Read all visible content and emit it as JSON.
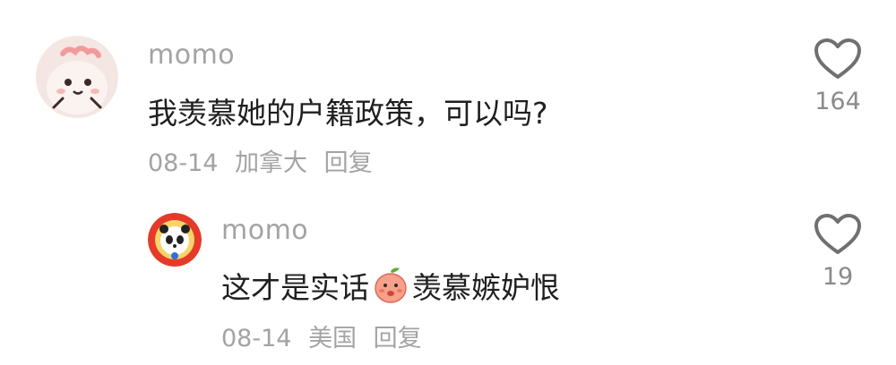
{
  "comments": [
    {
      "username": "momo",
      "text": "我羡慕她的户籍政策，可以吗?",
      "date": "08-14",
      "location": "加拿大",
      "reply_label": "回复",
      "like_count": "164"
    },
    {
      "username": "momo",
      "text_before_emoji": "这才是实话",
      "text_after_emoji": "羡慕嫉妒恨",
      "emoji_icon": "peach-emoji-icon",
      "date": "08-14",
      "location": "美国",
      "reply_label": "回复",
      "like_count": "19"
    }
  ]
}
